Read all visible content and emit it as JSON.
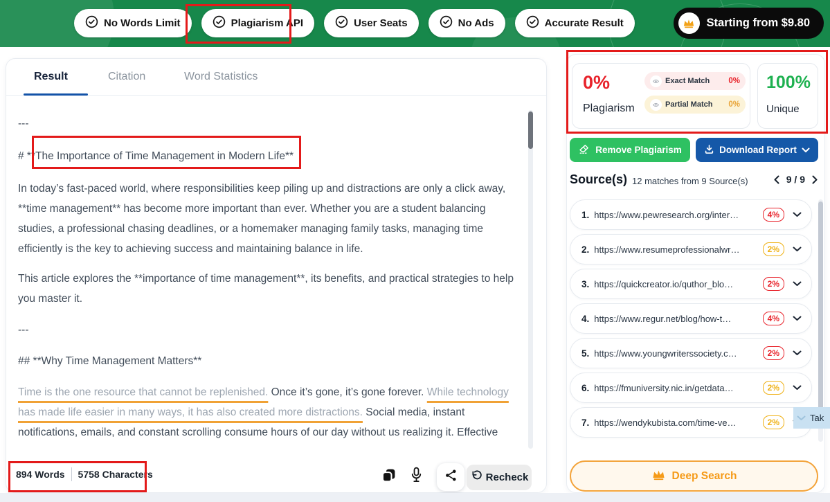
{
  "header": {
    "badges": [
      {
        "label": "No Words Limit"
      },
      {
        "label": "Plagiarism API"
      },
      {
        "label": "User Seats"
      },
      {
        "label": "No Ads"
      },
      {
        "label": "Accurate Result"
      }
    ],
    "pricing_label": "Starting from $9.80"
  },
  "tabs": {
    "result": "Result",
    "citation": "Citation",
    "word_statistics": "Word Statistics"
  },
  "document": {
    "divider1": "---",
    "heading1_prefix": "# **",
    "heading1_boxed": "The Importance of Time Management in Modern Life**",
    "para1": "In today’s fast-paced world, where responsibilities keep piling up and distractions are only a click away, **time management** has become more important than ever. Whether you are a student balancing studies, a professional chasing deadlines, or a homemaker managing family tasks, managing time efficiently is the key to achieving success and maintaining balance in life.",
    "para2": "This article explores the **importance of time management**, its benefits, and practical strategies to help you master it.",
    "divider2": "---",
    "heading2": "## **Why Time Management Matters**",
    "para3_seg1": "Time is the one resource that cannot be replenished.",
    "para3_seg2": " Once it’s gone, it’s gone forever. ",
    "para3_seg3": "While technology has made life easier in many ways, it has also created more distractions.",
    "para3_seg4": " Social media, instant",
    "para3_clipped": "notifications, emails, and constant scrolling consume hours of our day without us realizing it. Effective"
  },
  "footer": {
    "word_count": "894 Words",
    "char_count": "5758 Characters",
    "recheck_label": "Recheck"
  },
  "results": {
    "plagiarism_percent": "0%",
    "plagiarism_label": "Plagiarism",
    "exact_match_label": "Exact Match",
    "exact_match_value": "0%",
    "partial_match_label": "Partial Match",
    "partial_match_value": "0%",
    "unique_percent": "100%",
    "unique_label": "Unique",
    "remove_plagiarism_label": "Remove Plagiarism",
    "download_report_label": "Download Report"
  },
  "sources": {
    "title": "Source(s)",
    "subtitle": "12 matches from 9 Source(s)",
    "pagination": "9 / 9",
    "items": [
      {
        "num": "1.",
        "url": "https://www.pewresearch.org/inter…",
        "percent": "4%",
        "color": "#e8232b"
      },
      {
        "num": "2.",
        "url": "https://www.resumeprofessionalwr…",
        "percent": "2%",
        "color": "#efb013"
      },
      {
        "num": "3.",
        "url": "https://quickcreator.io/quthor_blo…",
        "percent": "2%",
        "color": "#e8232b"
      },
      {
        "num": "4.",
        "url": "https://www.regur.net/blog/how-t…",
        "percent": "4%",
        "color": "#e8232b"
      },
      {
        "num": "5.",
        "url": "https://www.youngwriterssociety.c…",
        "percent": "2%",
        "color": "#e8232b"
      },
      {
        "num": "6.",
        "url": "https://fmuniversity.nic.in/getdata…",
        "percent": "2%",
        "color": "#efb013"
      },
      {
        "num": "7.",
        "url": "https://wendykubista.com/time-ve…",
        "percent": "2%",
        "color": "#efb013",
        "active": true
      }
    ],
    "tooltip_text": "Tak",
    "deep_search_label": "Deep Search"
  },
  "colors": {
    "header_green": "#17884b",
    "annotation_red": "#e31a1a",
    "plagiarism_red": "#e8232b",
    "unique_green": "#1eb150",
    "warning_yellow": "#efb013",
    "primary_blue": "#1558a8",
    "success_green": "#2ec162",
    "deep_search_orange": "#f59a17"
  }
}
